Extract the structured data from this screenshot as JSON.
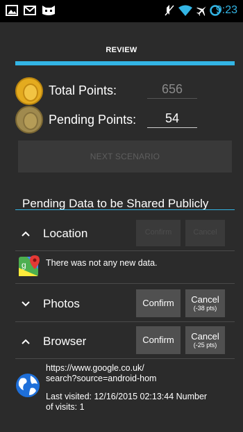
{
  "status_bar": {
    "time": "9:23",
    "left_icons": [
      "image-icon",
      "mail-icon",
      "cat-icon"
    ],
    "right_icons": [
      "mute-icon",
      "wifi-icon",
      "airplane-icon",
      "sync-circle-icon"
    ]
  },
  "header": {
    "title": "REVIEW"
  },
  "points": {
    "total_label": "Total Points:",
    "total_value": "656",
    "pending_label": "Pending Points:",
    "pending_value": "54"
  },
  "next_button": {
    "label": "NEXT SCENARIO"
  },
  "pending_section": {
    "title": "Pending Data to be Shared Publicly"
  },
  "categories": [
    {
      "label": "Location",
      "expanded": true,
      "confirm": "Confirm",
      "cancel": "Cancel",
      "cancel_sub": "",
      "enabled": false,
      "entries": [
        {
          "icon": "google-maps-icon",
          "text": "There was not any new data."
        }
      ]
    },
    {
      "label": "Photos",
      "expanded": false,
      "confirm": "Confirm",
      "cancel": "Cancel",
      "cancel_sub": "(-38 pts)",
      "enabled": true
    },
    {
      "label": "Browser",
      "expanded": true,
      "confirm": "Confirm",
      "cancel": "Cancel",
      "cancel_sub": "(-25 pts)",
      "enabled": true,
      "entries": [
        {
          "icon": "globe-icon",
          "url_line1": "https://www.google.co.uk/",
          "url_line2": "search?source=android-hom",
          "visit_line1": "Last visited: 12/16/2015 02:13:44 Number",
          "visit_line2": "of visits: 1"
        }
      ]
    }
  ],
  "colors": {
    "accent": "#33b5e5",
    "background": "#2b2b2b",
    "button": "#505050",
    "coin_gold": "#d9a41b"
  }
}
